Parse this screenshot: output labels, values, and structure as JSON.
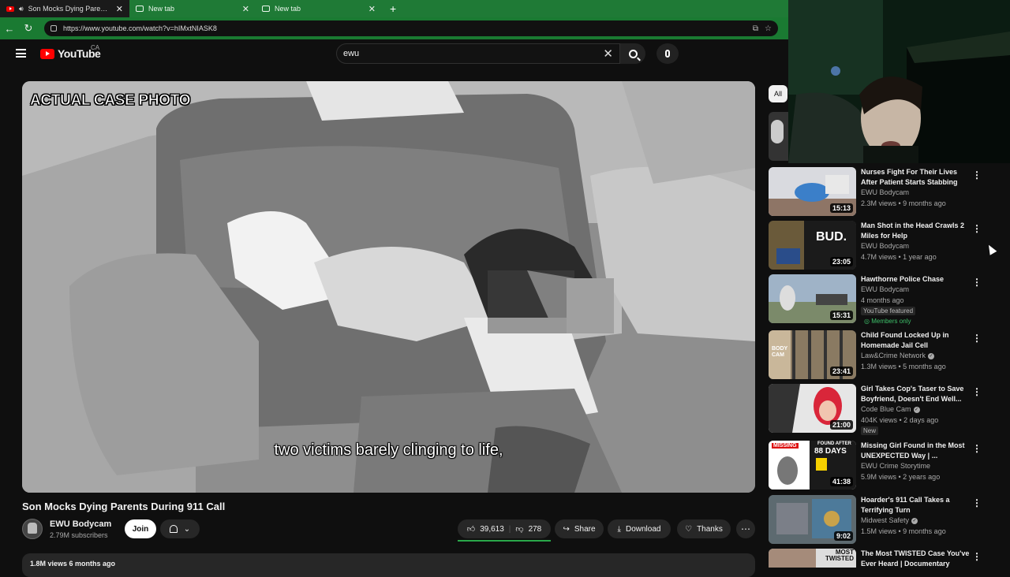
{
  "browser": {
    "tabs": [
      {
        "title": "Son Mocks Dying Parents Du",
        "active": true
      },
      {
        "title": "New tab",
        "active": false
      },
      {
        "title": "New tab",
        "active": false
      }
    ],
    "url": "https://www.youtube.com/watch?v=hIMxtNIASK8"
  },
  "header": {
    "logo_text": "YouTube",
    "country": "CA",
    "search_value": "ewu"
  },
  "video": {
    "overlay_text": "ACTUAL CASE PHOTO",
    "subtitle": "two victims barely clinging to life,",
    "title": "Son Mocks Dying Parents During 911 Call"
  },
  "channel": {
    "name": "EWU Bodycam",
    "subscribers": "2.79M subscribers",
    "join_label": "Join"
  },
  "actions": {
    "likes": "39,613",
    "dislikes": "278",
    "share": "Share",
    "download": "Download",
    "thanks": "Thanks"
  },
  "description": {
    "meta": "1.8M views  6 months ago"
  },
  "sidebar": {
    "chip_all": "All",
    "items": [
      {
        "title": "Nurses Fight For Their Lives After Patient Starts Stabbing",
        "channel": "EWU Bodycam",
        "meta": "2.3M views • 9 months ago",
        "duration": "15:13"
      },
      {
        "title": "Man Shot in the Head Crawls 2 Miles for Help",
        "channel": "EWU Bodycam",
        "meta": "4.7M views • 1 year ago",
        "duration": "23:05",
        "thumb_text": "BUD."
      },
      {
        "title": "Hawthorne Police Chase",
        "channel": "EWU Bodycam",
        "meta": "4 months ago",
        "duration": "15:31",
        "badge1": "YouTube featured",
        "badge2": "Members only"
      },
      {
        "title": "Child Found Locked Up in Homemade Jail Cell",
        "channel": "Law&Crime Network",
        "meta": "1.3M views • 5 months ago",
        "duration": "23:41",
        "thumb_text": "BODY CAM"
      },
      {
        "title": "Girl Takes Cop's Taser to Save Boyfriend, Doesn't End Well...",
        "channel": "Code Blue Cam",
        "meta": "404K views • 2 days ago",
        "duration": "21:00",
        "badge1": "New"
      },
      {
        "title": "Missing Girl Found in the Most UNEXPECTED Way | ...",
        "channel": "EWU Crime Storytime",
        "meta": "5.9M views • 2 years ago",
        "duration": "41:38",
        "thumb_text": "MISSING",
        "thumb_text2": "88 DAYS",
        "thumb_text3": "FOUND AFTER"
      },
      {
        "title": "Hoarder's 911 Call Takes a Terrifying Turn",
        "channel": "Midwest Safety",
        "meta": "1.5M views • 9 months ago",
        "duration": "9:02"
      },
      {
        "title": "The Most TWISTED Case You've Ever Heard | Documentary",
        "thumb_text": "MOST TWISTED"
      }
    ]
  }
}
